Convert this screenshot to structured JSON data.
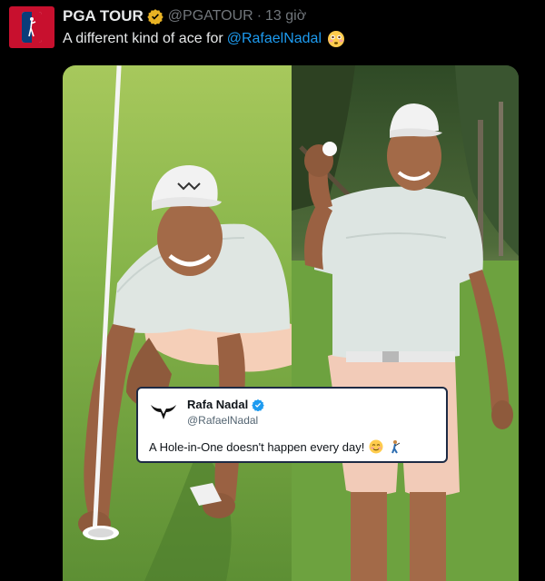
{
  "author": {
    "display_name": "PGA TOUR",
    "handle": "@PGATOUR",
    "separator": "·",
    "time": "13 giờ",
    "avatar_icon": "pga-tour-logo-icon",
    "verified_icon": "verified-gold-badge-icon"
  },
  "tweet": {
    "text": "A different kind of ace for",
    "mention": "@RafaelNadal",
    "emoji_icon": "flushed-face-emoji-icon"
  },
  "media": {
    "photos": [
      "golfer-picking-ball-from-hole-photo",
      "golfer-holding-ball-photo"
    ],
    "quote": {
      "display_name": "Rafa Nadal",
      "handle": "@RafaelNadal",
      "text": "A Hole-in-One doesn't happen every day!",
      "avatar_icon": "rafa-bull-logo-icon",
      "verified_icon": "verified-blue-badge-icon",
      "emoji_icons": [
        "smiling-face-emoji-icon",
        "golfer-emoji-icon"
      ]
    }
  },
  "colors": {
    "background": "#000000",
    "text": "#e7e9ea",
    "muted": "#71767b",
    "link": "#1d9bf0",
    "verified_gold": "#e8b224",
    "verified_blue": "#1d9bf0",
    "brand_red": "#c8102e",
    "brand_blue": "#0a3d7a"
  }
}
